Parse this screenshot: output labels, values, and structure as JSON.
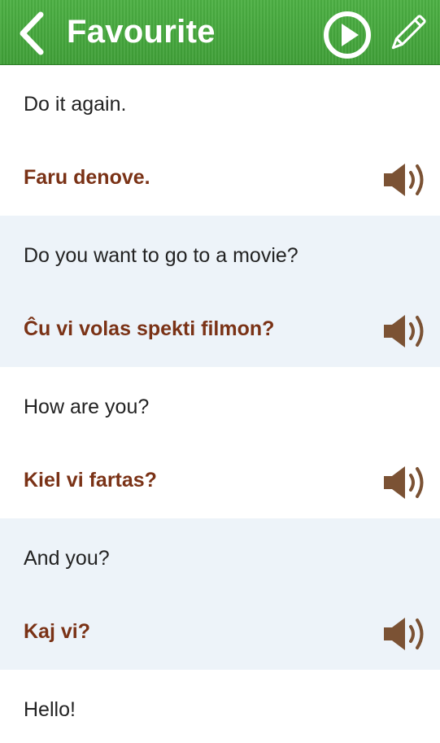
{
  "header": {
    "title": "Favourite"
  },
  "colors": {
    "header_green": "#4cb043",
    "translation_brown": "#7a3216",
    "speaker_brown": "#7b5234",
    "alt_row_bg": "#edf3f9"
  },
  "icons": [
    "chevron-left-icon",
    "play-circle-icon",
    "pencil-icon",
    "speaker-icon"
  ],
  "phrases": [
    {
      "phrase": "Do it again.",
      "translation": "Faru denove."
    },
    {
      "phrase": "Do you want to go to a movie?",
      "translation": "Ĉu vi volas spekti filmon?"
    },
    {
      "phrase": "How are you?",
      "translation": "Kiel vi fartas?"
    },
    {
      "phrase": "And you?",
      "translation": "Kaj vi?"
    },
    {
      "phrase": "Hello!"
    }
  ]
}
